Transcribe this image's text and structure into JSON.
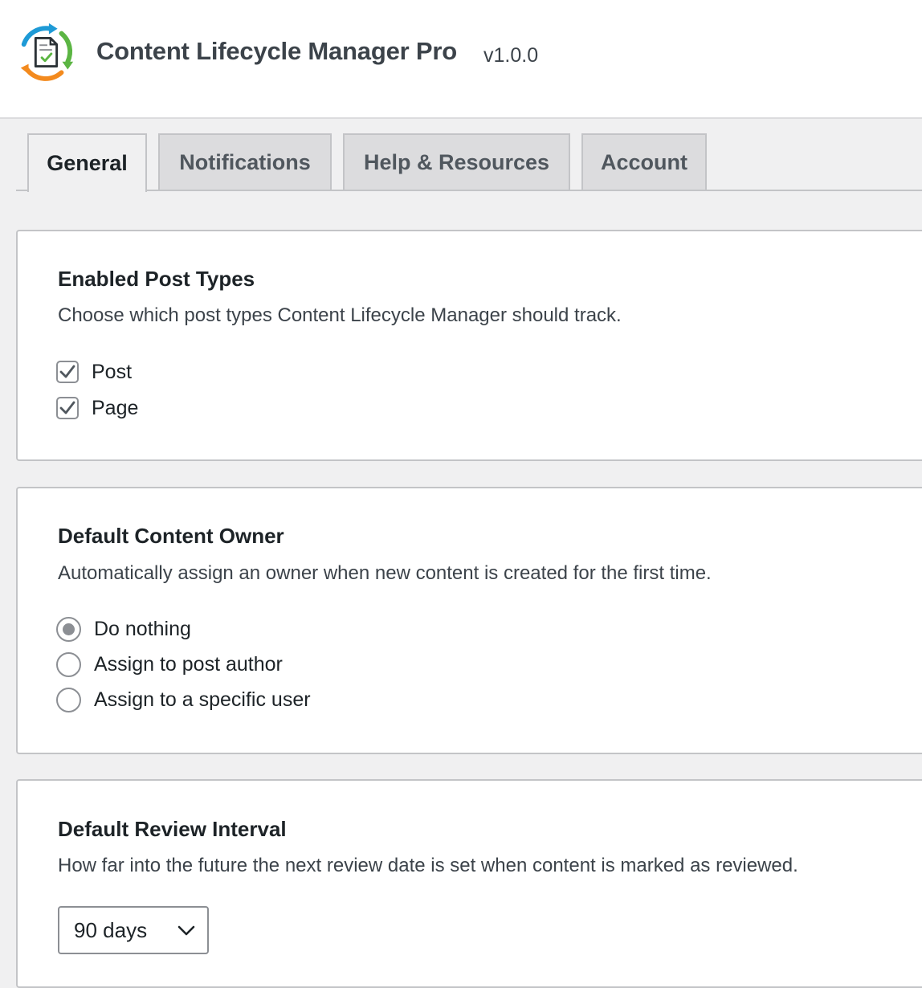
{
  "app": {
    "title": "Content Lifecycle Manager Pro",
    "version": "v1.0.0",
    "logo_icon": "lifecycle-document-check-icon"
  },
  "tabs": [
    {
      "label": "General",
      "active": true
    },
    {
      "label": "Notifications",
      "active": false
    },
    {
      "label": "Help & Resources",
      "active": false
    },
    {
      "label": "Account",
      "active": false
    }
  ],
  "post_types": {
    "title": "Enabled Post Types",
    "description": "Choose which post types Content Lifecycle Manager should track.",
    "options": [
      {
        "label": "Post",
        "checked": true
      },
      {
        "label": "Page",
        "checked": true
      }
    ]
  },
  "content_owner": {
    "title": "Default Content Owner",
    "description": "Automatically assign an owner when new content is created for the first time.",
    "options": [
      {
        "label": "Do nothing",
        "selected": true
      },
      {
        "label": "Assign to post author",
        "selected": false
      },
      {
        "label": "Assign to a specific user",
        "selected": false
      }
    ]
  },
  "review_interval": {
    "title": "Default Review Interval",
    "description": "How far into the future the next review date is set when content is marked as reviewed.",
    "selected_value": "90 days"
  },
  "colors": {
    "logo_blue": "#1e9ad6",
    "logo_green": "#5bb543",
    "logo_orange": "#f38a1e",
    "page_background": "#f0f0f1",
    "border": "#c3c4c7"
  }
}
